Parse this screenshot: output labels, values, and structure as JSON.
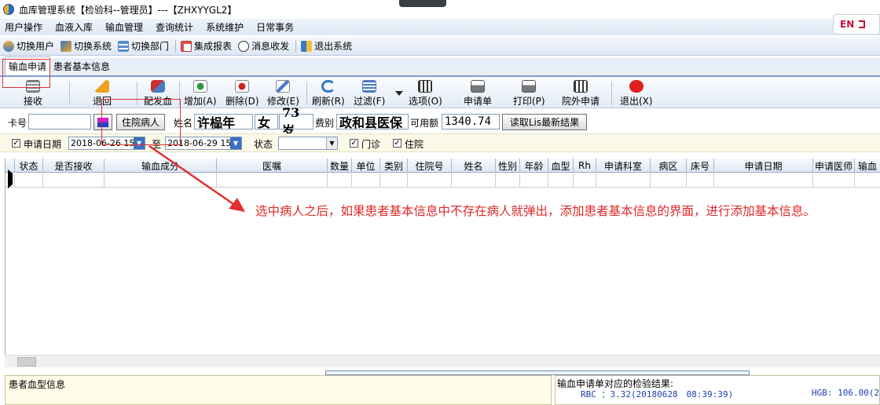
{
  "window": {
    "title": "血库管理系统【检验科--管理员】---【ZHXYYGL2】"
  },
  "menu": [
    "用户操作",
    "血液入库",
    "输血管理",
    "查询统计",
    "系统维护",
    "日常事务"
  ],
  "lang_badge": "EN",
  "toolbar": [
    {
      "label": "切换用户",
      "icon": "switch-user-icon"
    },
    {
      "label": "切换系统",
      "icon": "switch-system-icon"
    },
    {
      "label": "切换部门",
      "icon": "switch-department-icon"
    },
    {
      "label": "集成报表",
      "icon": "report-icon"
    },
    {
      "label": "消息收发",
      "icon": "message-icon"
    },
    {
      "label": "退出系统",
      "icon": "exit-system-icon"
    }
  ],
  "tabs": [
    {
      "label": "输血申请",
      "active": true
    },
    {
      "label": "患者基本信息",
      "active": false
    }
  ],
  "actions": {
    "receive": "接收",
    "return": "退回",
    "match": "配发血",
    "add": "增加(A)",
    "delete": "删除(D)",
    "edit": "修改(E)",
    "refresh": "刷新(R)",
    "filter": "过滤(F)",
    "options": "选项(O)",
    "request_form": "申请单",
    "print": "打印(P)",
    "outside": "院外申请",
    "quit": "退出(X)"
  },
  "patient": {
    "card_label": "卡号",
    "card_value": "",
    "inpatient_button": "住院病人",
    "name_label": "姓名",
    "name": "许榀年",
    "sex": "女",
    "age": "73岁",
    "fee_label": "费别",
    "fee_type": "政和县医保",
    "balance_label": "可用额",
    "balance": "1340.74",
    "lis_button": "读取Lis最新结果"
  },
  "filter": {
    "date_label": "申请日期",
    "date_from": "2018-06-26 15",
    "to_label": "至",
    "date_to": "2018-06-29 15",
    "status_label": "状态",
    "status_value": "",
    "outpatient_label": "门诊",
    "inpatient_label": "住院",
    "date_checked": true,
    "outpatient_checked": true,
    "inpatient_checked": true
  },
  "grid": {
    "columns": [
      "状态",
      "是否接收",
      "输血成分",
      "医嘱",
      "数量",
      "单位",
      "类别",
      "住院号",
      "姓名",
      "性别",
      "年龄",
      "血型",
      "Rh",
      "申请科室",
      "病区",
      "床号",
      "申请日期",
      "申请医师",
      "输血"
    ]
  },
  "annotation": "选中病人之后，如果患者基本信息中不存在病人就弹出，添加患者基本信息的界面，进行添加基本信息。",
  "bottom": {
    "blood_type_label": "患者血型信息",
    "lab_results_label": "输血申请单对应的检验结果:",
    "rbc_line": "RBC ：3.32(20180628　08:39:39)",
    "hgb_line": "HGB: 106.00(2"
  },
  "colors": {
    "annotation": "#e02828",
    "highlight_box": "#e03030",
    "result_text": "#1f3fb0"
  }
}
